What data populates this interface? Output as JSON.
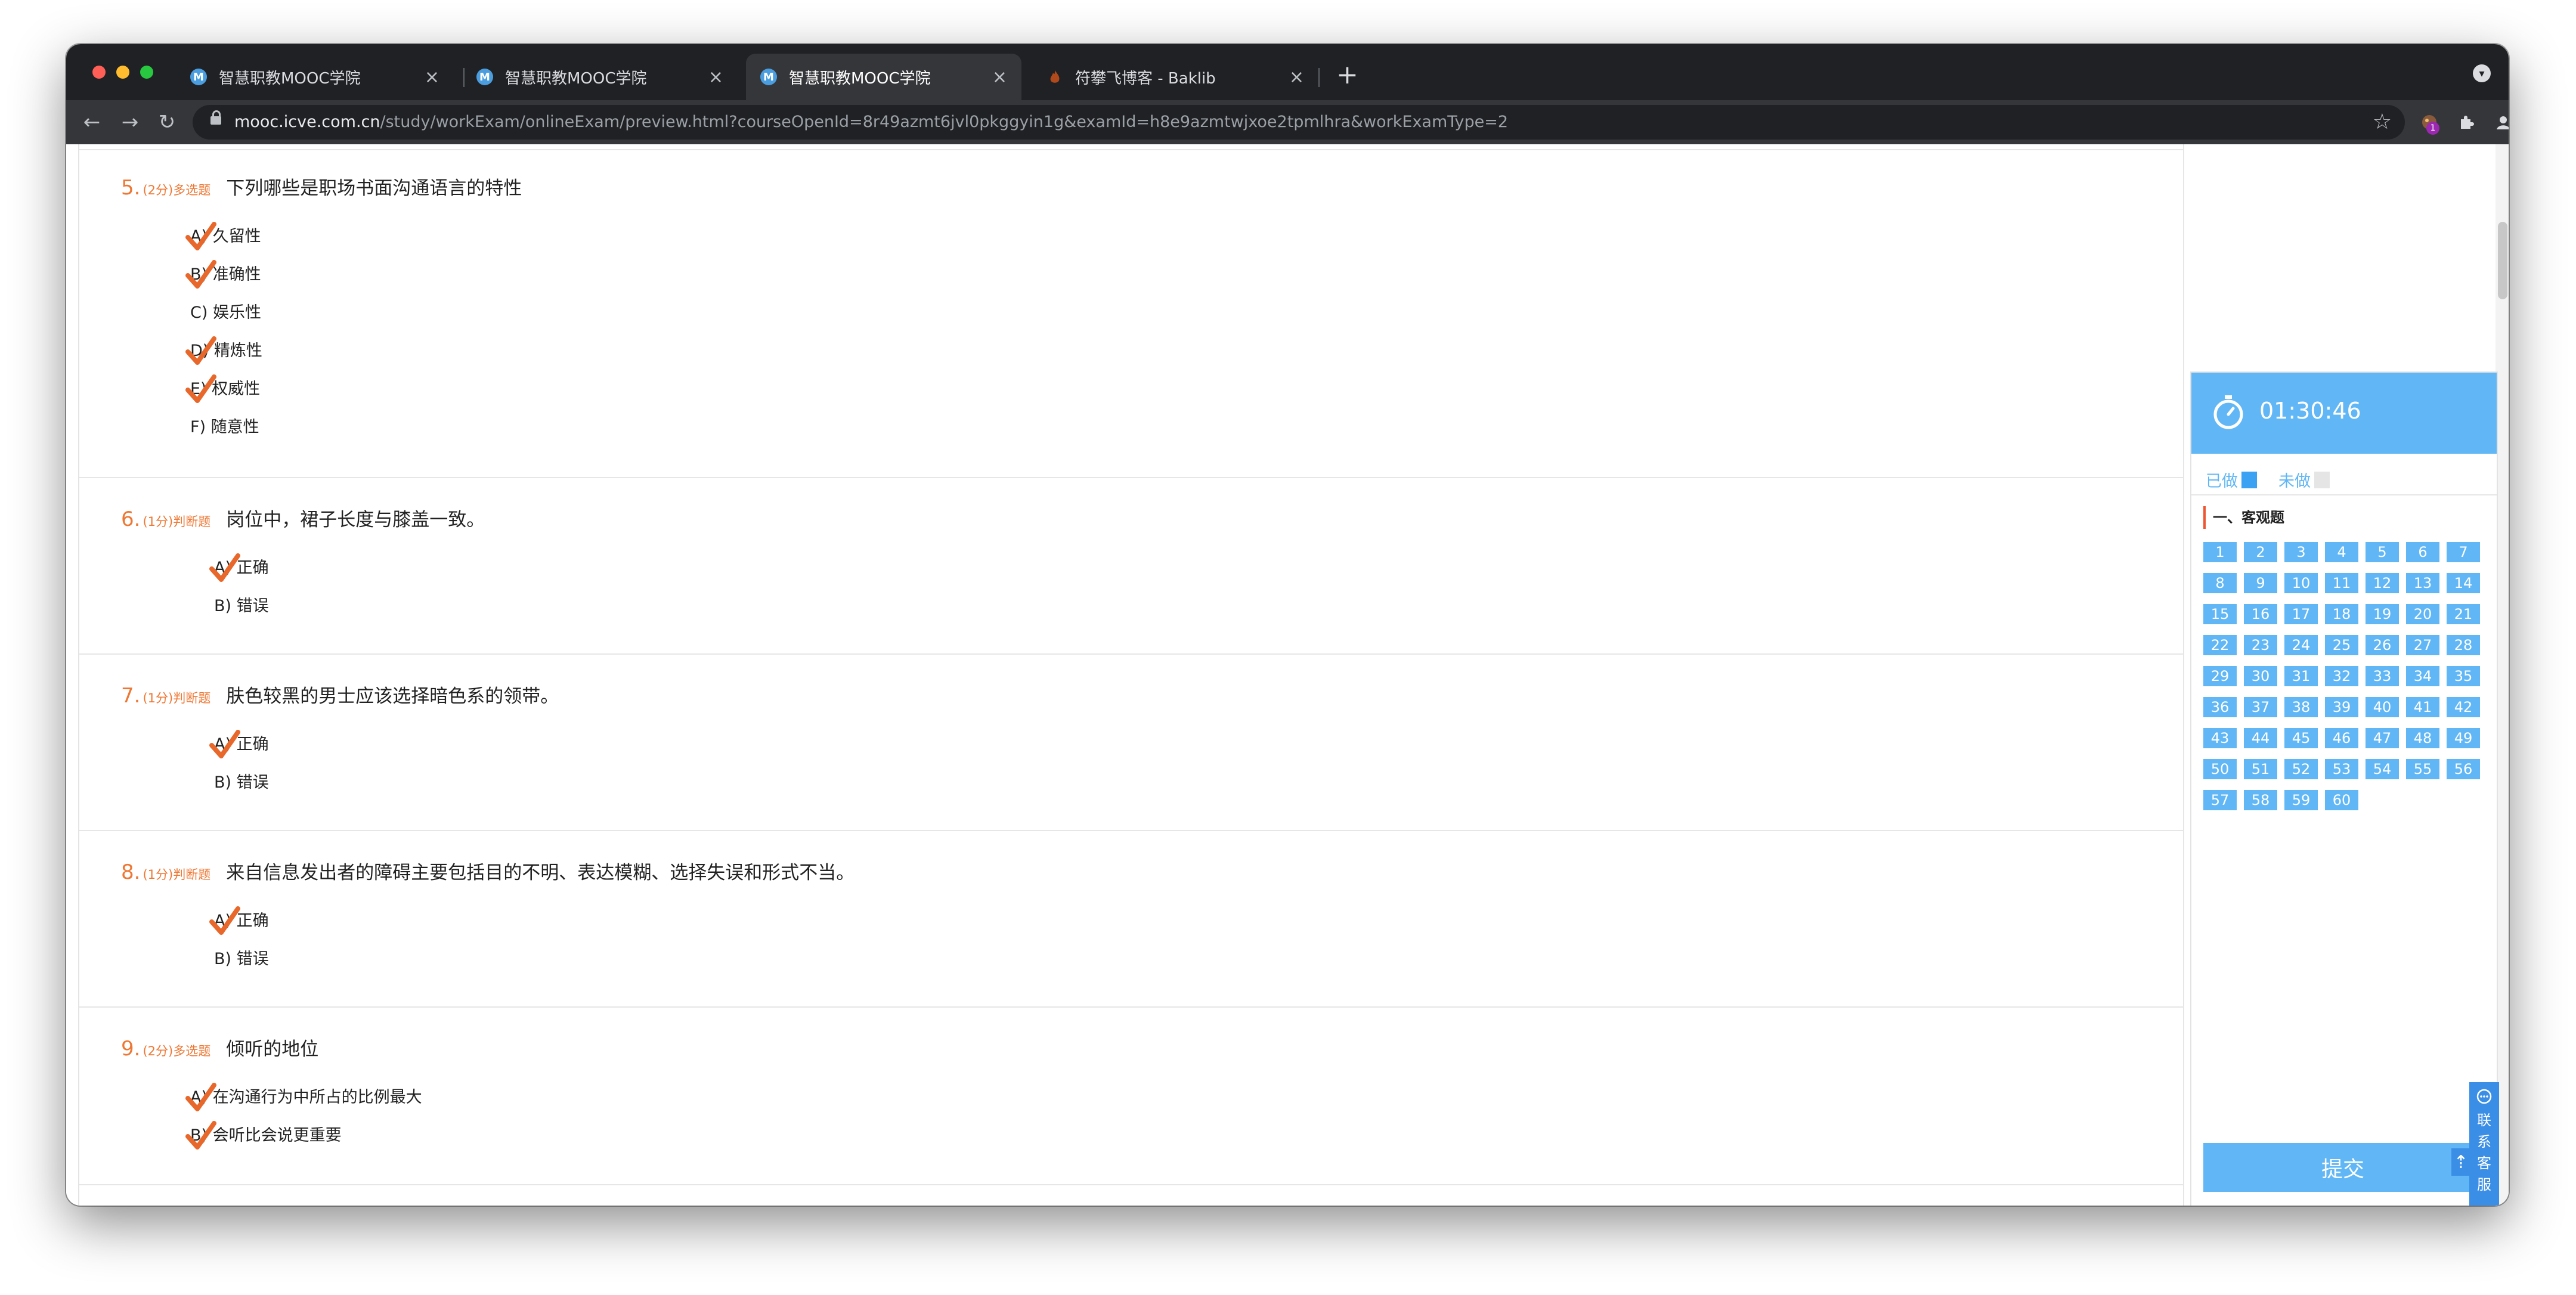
{
  "tabs": [
    {
      "label": "智慧职教MOOC学院",
      "icon": "M",
      "active": false
    },
    {
      "label": "智慧职教MOOC学院",
      "icon": "M",
      "active": false
    },
    {
      "label": "智慧职教MOOC学院",
      "icon": "M",
      "active": true
    },
    {
      "label": "符攀飞博客 - Baklib",
      "icon": "blog-icon",
      "active": false
    }
  ],
  "address": {
    "domain": "mooc.icve.com.cn",
    "path": "/study/workExam/onlineExam/preview.html?courseOpenId=8r49azmt6jvl0pkggyin1g&examId=h8e9azmtwjxoe2tpmlhra&workExamType=2"
  },
  "extension_badge": "1",
  "questions": [
    {
      "num": "5.",
      "meta": "(2分)多选题",
      "text": "下列哪些是职场书面沟通语言的特性",
      "options": [
        {
          "label": "A) 久留性",
          "checked": true
        },
        {
          "label": "B) 准确性",
          "checked": true
        },
        {
          "label": "C) 娱乐性",
          "checked": false
        },
        {
          "label": "D) 精炼性",
          "checked": true
        },
        {
          "label": "E) 权威性",
          "checked": true
        },
        {
          "label": "F) 随意性",
          "checked": false
        }
      ]
    },
    {
      "num": "6.",
      "meta": "(1分)判断题",
      "text": "岗位中，裙子长度与膝盖一致。",
      "options": [
        {
          "label": "A) 正确",
          "checked": true
        },
        {
          "label": "B) 错误",
          "checked": false
        }
      ]
    },
    {
      "num": "7.",
      "meta": "(1分)判断题",
      "text": "肤色较黑的男士应该选择暗色系的领带。",
      "options": [
        {
          "label": "A) 正确",
          "checked": true
        },
        {
          "label": "B) 错误",
          "checked": false
        }
      ]
    },
    {
      "num": "8.",
      "meta": "(1分)判断题",
      "text": "来自信息发出者的障碍主要包括目的不明、表达模糊、选择失误和形式不当。",
      "options": [
        {
          "label": "A) 正确",
          "checked": true
        },
        {
          "label": "B) 错误",
          "checked": false
        }
      ]
    },
    {
      "num": "9.",
      "meta": "(2分)多选题",
      "text": "倾听的地位",
      "options": [
        {
          "label": "A) 在沟通行为中所占的比例最大",
          "checked": true
        },
        {
          "label": "B) 会听比会说更重要",
          "checked": true
        }
      ]
    }
  ],
  "sidebar": {
    "timer": "01:30:46",
    "legend_done": "已做",
    "legend_undone": "未做",
    "section_title": "一、客观题",
    "numbers": [
      "1",
      "2",
      "3",
      "4",
      "5",
      "6",
      "7",
      "8",
      "9",
      "10",
      "11",
      "12",
      "13",
      "14",
      "15",
      "16",
      "17",
      "18",
      "19",
      "20",
      "21",
      "22",
      "23",
      "24",
      "25",
      "26",
      "27",
      "28",
      "29",
      "30",
      "31",
      "32",
      "33",
      "34",
      "35",
      "36",
      "37",
      "38",
      "39",
      "40",
      "41",
      "42",
      "43",
      "44",
      "45",
      "46",
      "47",
      "48",
      "49",
      "50",
      "51",
      "52",
      "53",
      "54",
      "55",
      "56",
      "57",
      "58",
      "59",
      "60"
    ],
    "submit": "提交",
    "contact": [
      "联",
      "系",
      "客",
      "服"
    ]
  },
  "colors": {
    "accent": "#61b7f6",
    "question_number": "#ee7733",
    "check": "#e8672a",
    "tab_bar": "#202124"
  }
}
